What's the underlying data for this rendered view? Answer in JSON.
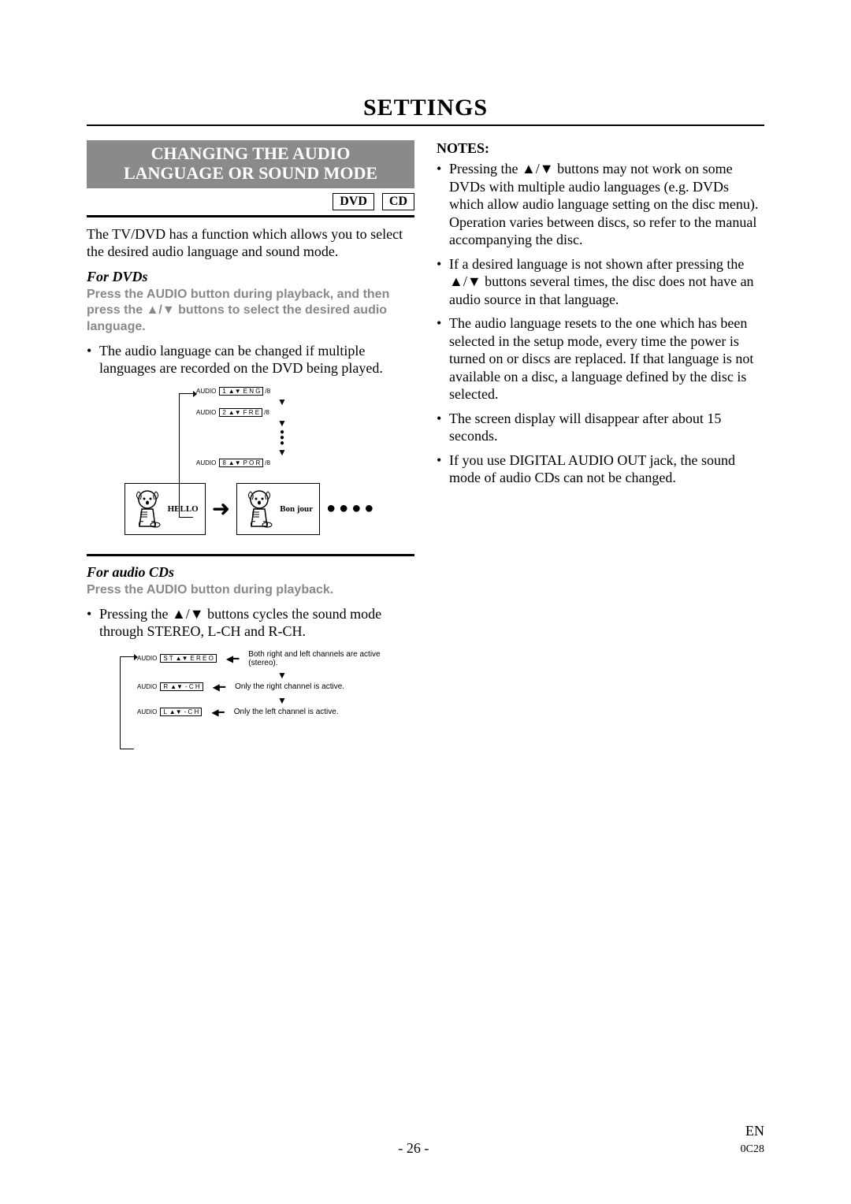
{
  "page_title": "SETTINGS",
  "section_header_line1": "CHANGING THE AUDIO",
  "section_header_line2": "LANGUAGE OR SOUND MODE",
  "disc_tags": {
    "dvd": "DVD",
    "cd": "CD"
  },
  "intro": "The TV/DVD has a function which allows you to select the desired audio language and sound mode.",
  "for_dvds": {
    "heading": "For DVDs",
    "instruction": "Press the AUDIO button during playback, and then press the ▲/▼ buttons to select the desired audio language.",
    "bullet": "The audio language can be changed if multiple languages are recorded on the DVD being played.",
    "diagram": {
      "audio_prefix": "AUDIO",
      "rows": [
        {
          "num": "1",
          "code": "E N G",
          "suffix": "/8"
        },
        {
          "num": "2",
          "code": "F R E",
          "suffix": "/8"
        },
        {
          "num": "8",
          "code": "P O R",
          "suffix": "/8"
        }
      ],
      "hello": "HELLO",
      "bonjour": "Bon jour"
    }
  },
  "for_cds": {
    "heading": "For audio CDs",
    "instruction": "Press the AUDIO button during playback.",
    "bullet": "Pressing the ▲/▼ buttons cycles the sound mode through STEREO, L-CH and R-CH.",
    "diagram": {
      "audio_prefix": "AUDIO",
      "rows": [
        {
          "num": "S T",
          "code": "E R E O",
          "desc": "Both right and left channels are active (stereo)."
        },
        {
          "num": "R",
          "code": "- C H",
          "desc": "Only the right channel is active."
        },
        {
          "num": "L",
          "code": "- C H",
          "desc": "Only the left channel is active."
        }
      ]
    }
  },
  "notes": {
    "heading": "NOTES:",
    "items": [
      "Pressing the ▲/▼ buttons may not work on some DVDs with multiple audio languages (e.g. DVDs which allow audio language setting on the disc menu). Operation varies between discs, so refer to the manual accompanying the disc.",
      "If a desired language is not shown after pressing the ▲/▼ buttons several times, the disc does not have an audio source in that language.",
      "The audio language resets to the one which has been selected in the setup mode, every time the power is turned on or discs are replaced. If that language is not available on a disc, a language defined by the disc is selected.",
      "The screen display will disappear after about 15 seconds.",
      "If you use DIGITAL AUDIO OUT jack, the sound mode of audio CDs can not be changed."
    ]
  },
  "footer": {
    "page": "- 26 -",
    "lang": "EN",
    "code": "0C28"
  }
}
